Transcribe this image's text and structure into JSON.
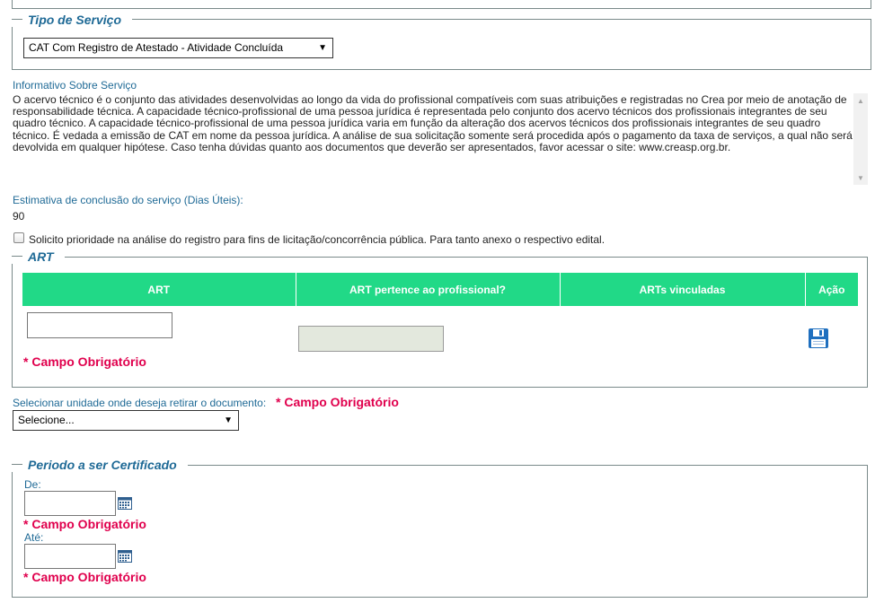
{
  "tipo_servico": {
    "legend": "Tipo de Serviço",
    "selected": "CAT Com Registro de Atestado - Atividade Concluída",
    "arrow": "▼"
  },
  "informativo": {
    "label": "Informativo Sobre Serviço",
    "text": "O acervo técnico é o conjunto das atividades desenvolvidas ao longo da vida do profissional compatíveis com suas atribuições e registradas no Crea por meio de anotação de responsabilidade técnica. A capacidade técnico-profissional de uma pessoa jurídica é representada pelo conjunto dos acervo técnicos dos profissionais integrantes de seu quadro técnico. A capacidade técnico-profissional de uma pessoa jurídica varia em função da alteração dos acervos técnicos dos profissionais integrantes de seu quadro técnico. É vedada a emissão de CAT em nome da pessoa jurídica. A análise de sua solicitação somente será procedida após o pagamento da taxa de serviços, a qual não será devolvida em qualquer hipótese. Caso tenha dúvidas quanto aos documentos que deverão ser apresentados, favor acessar o site: www.creasp.org.br.",
    "scroll_up": "▲",
    "scroll_down": "▼"
  },
  "estimativa": {
    "label": "Estimativa de conclusão do serviço (Dias Úteis):",
    "value": "90"
  },
  "prioridade": {
    "label": "Solicito prioridade na análise do registro para fins de licitação/concorrência pública. Para tanto anexo o respectivo edital.",
    "checked": false
  },
  "art": {
    "legend": "ART",
    "columns": [
      "ART",
      "ART pertence ao profissional?",
      "ARTs vinculadas",
      "Ação"
    ],
    "art_value": "",
    "pertence_value": "",
    "required": "* Campo Obrigatório",
    "save_icon_color": "#1f6fbf"
  },
  "unidade": {
    "label": "Selecionar unidade onde deseja retirar o documento:",
    "required": "* Campo Obrigatório",
    "selected": "Selecione...",
    "arrow": "▼"
  },
  "periodo": {
    "legend": "Periodo a ser Certificado",
    "de_label": "De:",
    "de_value": "",
    "de_required": "* Campo Obrigatório",
    "ate_label": "Até:",
    "ate_value": "",
    "ate_required": "* Campo Obrigatório"
  },
  "colors": {
    "header_green": "#21d987",
    "legend_blue": "#1f6a96",
    "required_red": "#e0004d"
  }
}
